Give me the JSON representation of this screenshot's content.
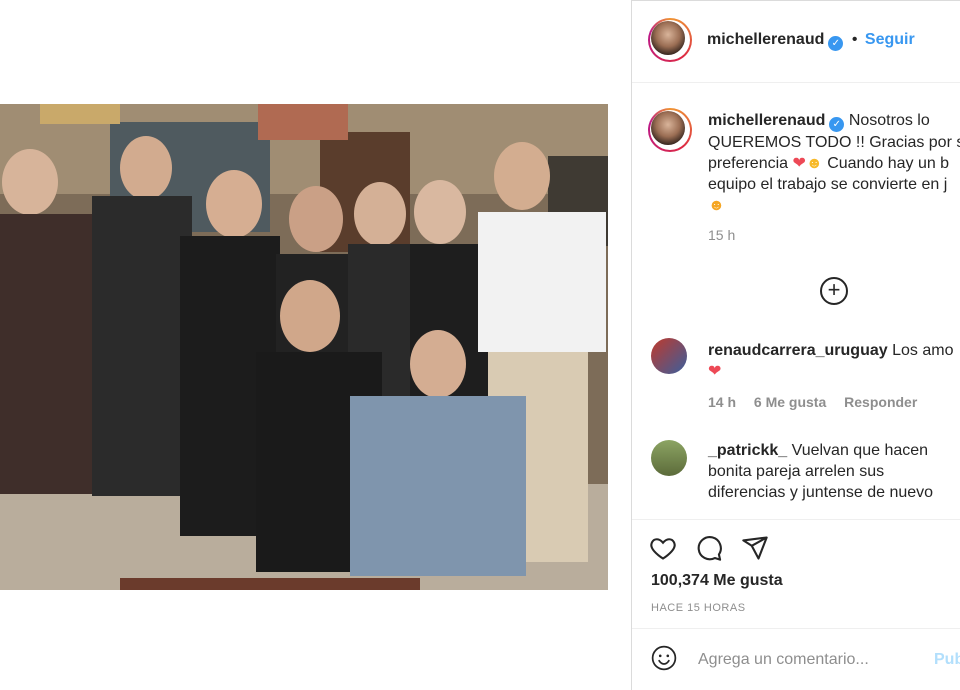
{
  "post": {
    "username": "michellerenaud",
    "follow_label": "Seguir",
    "separator": "•",
    "caption_line1": "Nosotros lo",
    "caption_line2": "QUEREMOS TODO !! Gracias por s",
    "caption_line3a": "preferencia",
    "caption_line3b": "Cuando hay un b",
    "caption_line4": "equipo el trabajo se convierte en j",
    "caption_time": "15 h",
    "image_alt": "Group photo of cast members in a living room set"
  },
  "comments": [
    {
      "username": "renaudcarrera_uruguay",
      "text": "Los amo",
      "time": "14 h",
      "likes": "6 Me gusta",
      "reply": "Responder"
    },
    {
      "username": "_patrickk_",
      "text_line1": "Vuelvan que hacen",
      "text_line2": "bonita pareja arrelen sus",
      "text_line3": "diferencias y juntense de nuevo"
    }
  ],
  "stats": {
    "likes": "100,374 Me gusta",
    "posted": "HACE 15 HORAS"
  },
  "composer": {
    "placeholder": "Agrega un comentario...",
    "publish_label": "Publ"
  },
  "colors": {
    "accent": "#3897f0",
    "heart": "#ed4956"
  },
  "icons": [
    "verified-badge-icon",
    "add-comment-icon",
    "heart-icon",
    "comment-icon",
    "share-icon",
    "emoji-icon"
  ]
}
